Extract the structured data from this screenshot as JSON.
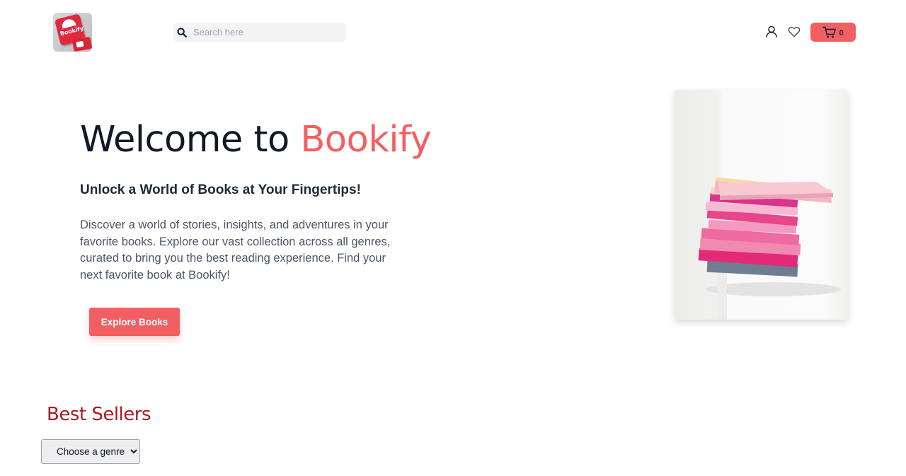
{
  "header": {
    "logo_text": "Bookify",
    "search": {
      "placeholder": "Search here",
      "value": ""
    },
    "icons": [
      "user-icon",
      "heart-icon",
      "cart-icon",
      "search-icon"
    ],
    "cart": {
      "count": "0"
    }
  },
  "hero": {
    "title_prefix": "Welcome to ",
    "title_brand": "Bookify",
    "subtitle": "Unlock a World of Books at Your Fingertips!",
    "description": "Discover a world of stories, insights, and adventures in your favorite books. Explore our vast collection across all genres, curated to bring you the best reading experience. Find your next favorite book at Bookify!",
    "button_label": "Explore Books"
  },
  "best_sellers": {
    "title": "Best Sellers",
    "genre_select": {
      "selected": "Choose a genre"
    }
  },
  "colors": {
    "accent": "#f25f62",
    "section_title": "#a51d24",
    "heading": "#111827"
  }
}
